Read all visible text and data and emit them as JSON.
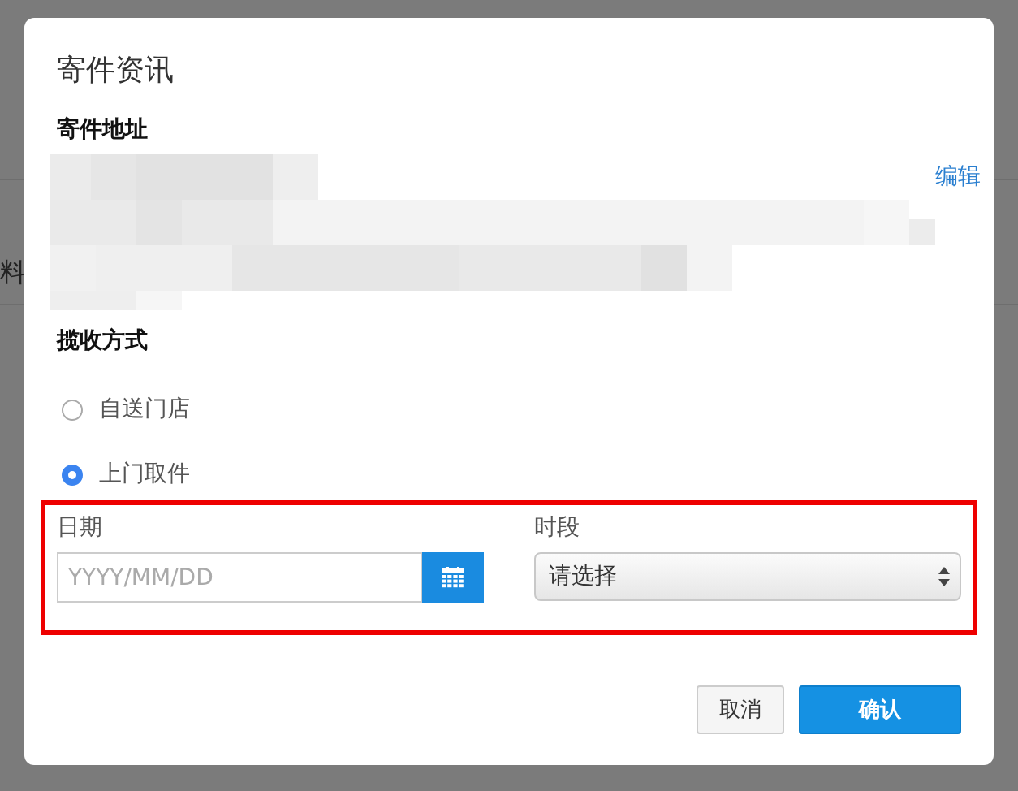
{
  "background_page": {
    "text": "料"
  },
  "dialog": {
    "title": "寄件资讯",
    "address": {
      "label": "寄件地址",
      "edit_link": "编辑"
    },
    "pickup": {
      "label": "揽收方式",
      "options": [
        {
          "label": "自送门店",
          "selected": false
        },
        {
          "label": "上门取件",
          "selected": true
        }
      ]
    },
    "date": {
      "label": "日期",
      "placeholder": "YYYY/MM/DD"
    },
    "time_slot": {
      "label": "时段",
      "value": "请选择"
    },
    "buttons": [
      {
        "label": "取消",
        "kind": "secondary"
      },
      {
        "label": "确认",
        "kind": "primary"
      }
    ]
  }
}
